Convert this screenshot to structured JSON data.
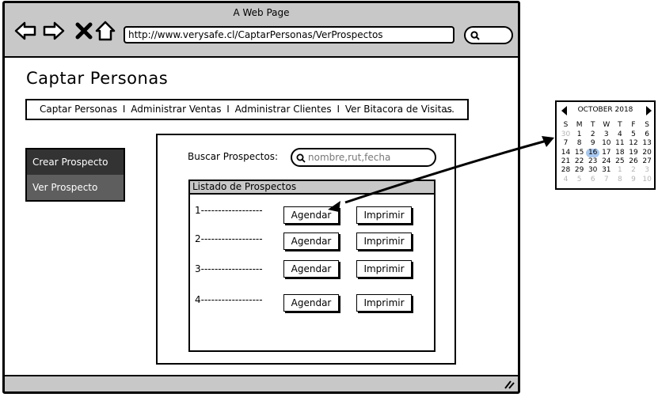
{
  "window": {
    "title": "A Web Page"
  },
  "browser": {
    "url": "http://www.verysafe.cl/CaptarPersonas/VerProspectos",
    "icons": [
      "back-arrow-icon",
      "forward-arrow-icon",
      "close-icon",
      "home-icon",
      "search-icon"
    ]
  },
  "page": {
    "title": "Captar Personas"
  },
  "menu": {
    "items": [
      "Captar Personas",
      "Administrar Ventas",
      "Administrar Clientes",
      "Ver Bitacora de Visitas"
    ],
    "separator": "I",
    "more": "..."
  },
  "sidenav": {
    "items": [
      {
        "label": "Crear Prospecto"
      },
      {
        "label": "Ver Prospecto"
      }
    ]
  },
  "search": {
    "label": "Buscar Prospectos:",
    "placeholder": "nombre,rut,fecha"
  },
  "list": {
    "title": "Listado de Prospectos",
    "rows": [
      {
        "label": "1------------------",
        "schedule": "Agendar",
        "print": "Imprimir"
      },
      {
        "label": "2------------------",
        "schedule": "Agendar",
        "print": "Imprimir"
      },
      {
        "label": "3------------------",
        "schedule": "Agendar",
        "print": "Imprimir"
      },
      {
        "label": "4------------------",
        "schedule": "Agendar",
        "print": "Imprimir"
      }
    ]
  },
  "calendar": {
    "month": "OCTOBER 2018",
    "weekdays": [
      "S",
      "M",
      "T",
      "W",
      "T",
      "F",
      "S"
    ],
    "weeks": [
      [
        {
          "d": "30",
          "m": true
        },
        {
          "d": "1"
        },
        {
          "d": "2"
        },
        {
          "d": "3"
        },
        {
          "d": "4"
        },
        {
          "d": "5"
        },
        {
          "d": "6"
        }
      ],
      [
        {
          "d": "7"
        },
        {
          "d": "8"
        },
        {
          "d": "9"
        },
        {
          "d": "10"
        },
        {
          "d": "11"
        },
        {
          "d": "12"
        },
        {
          "d": "13"
        }
      ],
      [
        {
          "d": "14"
        },
        {
          "d": "15"
        },
        {
          "d": "16",
          "t": true
        },
        {
          "d": "17"
        },
        {
          "d": "18"
        },
        {
          "d": "19"
        },
        {
          "d": "20"
        }
      ],
      [
        {
          "d": "21"
        },
        {
          "d": "22"
        },
        {
          "d": "23"
        },
        {
          "d": "24"
        },
        {
          "d": "25"
        },
        {
          "d": "26"
        },
        {
          "d": "27"
        }
      ],
      [
        {
          "d": "28"
        },
        {
          "d": "29"
        },
        {
          "d": "30"
        },
        {
          "d": "31"
        },
        {
          "d": "1",
          "m": true
        },
        {
          "d": "2",
          "m": true
        },
        {
          "d": "3",
          "m": true
        }
      ],
      [
        {
          "d": "4",
          "m": true
        },
        {
          "d": "5",
          "m": true
        },
        {
          "d": "6",
          "m": true
        },
        {
          "d": "7",
          "m": true
        },
        {
          "d": "8",
          "m": true
        },
        {
          "d": "9",
          "m": true
        },
        {
          "d": "10",
          "m": true
        }
      ]
    ],
    "today_color": "#a8c8f0"
  },
  "colors": {
    "chrome": "#c8c8c8",
    "sidenav_bg": "#4d4d4d",
    "sidenav_active": "#333333"
  }
}
